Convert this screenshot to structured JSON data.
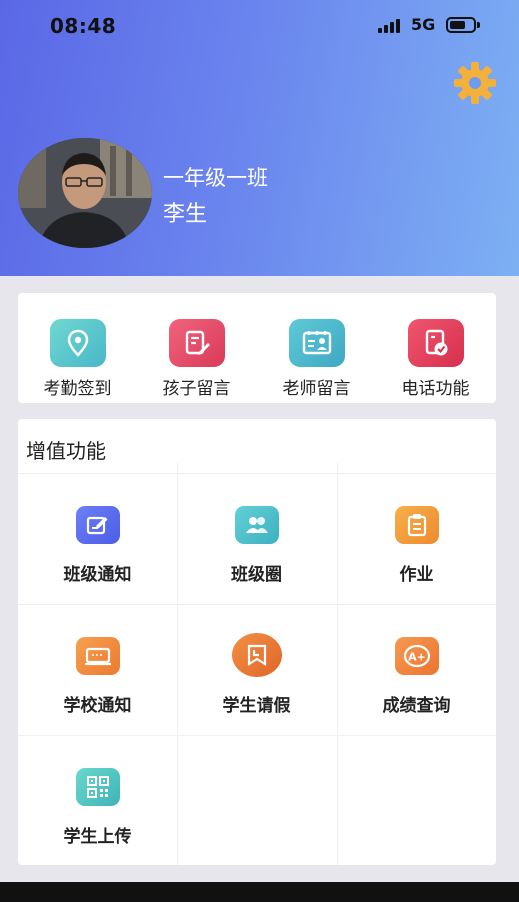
{
  "status_bar": {
    "time": "08:48",
    "network": "5G"
  },
  "header": {
    "class_name": "一年级一班",
    "user_name": "李生"
  },
  "quick_actions": [
    {
      "label": "考勤签到",
      "icon": "location-pin-icon",
      "color": "#4fc7c0"
    },
    {
      "label": "孩子留言",
      "icon": "edit-note-icon",
      "color": "#e8506a"
    },
    {
      "label": "老师留言",
      "icon": "teacher-board-icon",
      "color": "#4cb7c9"
    },
    {
      "label": "电话功能",
      "icon": "phone-card-icon",
      "color": "#e5405c"
    }
  ],
  "value_added": {
    "title": "增值功能",
    "items": [
      {
        "label": "班级通知",
        "icon": "edit-notice-icon",
        "color": "#5b6ef0"
      },
      {
        "label": "班级圈",
        "icon": "people-group-icon",
        "color": "#4cc0c8"
      },
      {
        "label": "作业",
        "icon": "clipboard-icon",
        "color": "#f29a3c"
      },
      {
        "label": "学校通知",
        "icon": "monitor-icon",
        "color": "#f08a3a"
      },
      {
        "label": "学生请假",
        "icon": "leave-clock-icon",
        "color": "#e8762e"
      },
      {
        "label": "成绩查询",
        "icon": "grade-a-plus-icon",
        "color": "#f0803a"
      },
      {
        "label": "学生上传",
        "icon": "qr-code-icon",
        "color": "#4cc2bf"
      }
    ]
  }
}
